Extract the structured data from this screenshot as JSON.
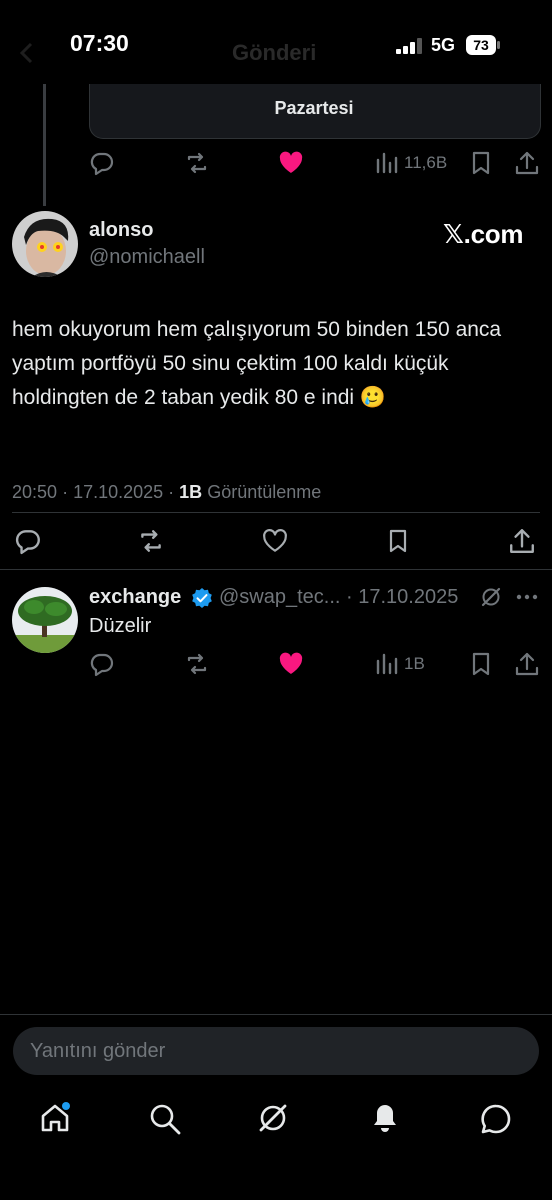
{
  "status_bar": {
    "time": "07:30",
    "network": "5G",
    "battery": "73"
  },
  "header": {
    "title": "Gönderi"
  },
  "quoted_tweet": {
    "card_label": "Pazartesi",
    "views": "11,6B"
  },
  "main_tweet": {
    "name": "alonso",
    "handle": "@nomichaell",
    "source_logo": "𝕏.com",
    "text": "hem okuyorum hem çalışıyorum 50 binden 150 anca yaptım portföyü 50 sinu çektim 100 kaldı küçük holdingten de 2 taban yedik 80 e indi 🥲",
    "time": "20:50",
    "date": "17.10.2025",
    "views_count": "1B",
    "views_label": "Görüntülenme"
  },
  "reply": {
    "name": "exchange",
    "handle": "@swap_tec...",
    "date": "17.10.2025",
    "text": "Düzelir",
    "views": "1B"
  },
  "composer": {
    "placeholder": "Yanıtını gönder"
  },
  "icons": {
    "liked_color": "#f91880",
    "muted_color": "#71767b",
    "verified_color": "#1d9bf0",
    "notification_dot": "#1d9bf0"
  }
}
